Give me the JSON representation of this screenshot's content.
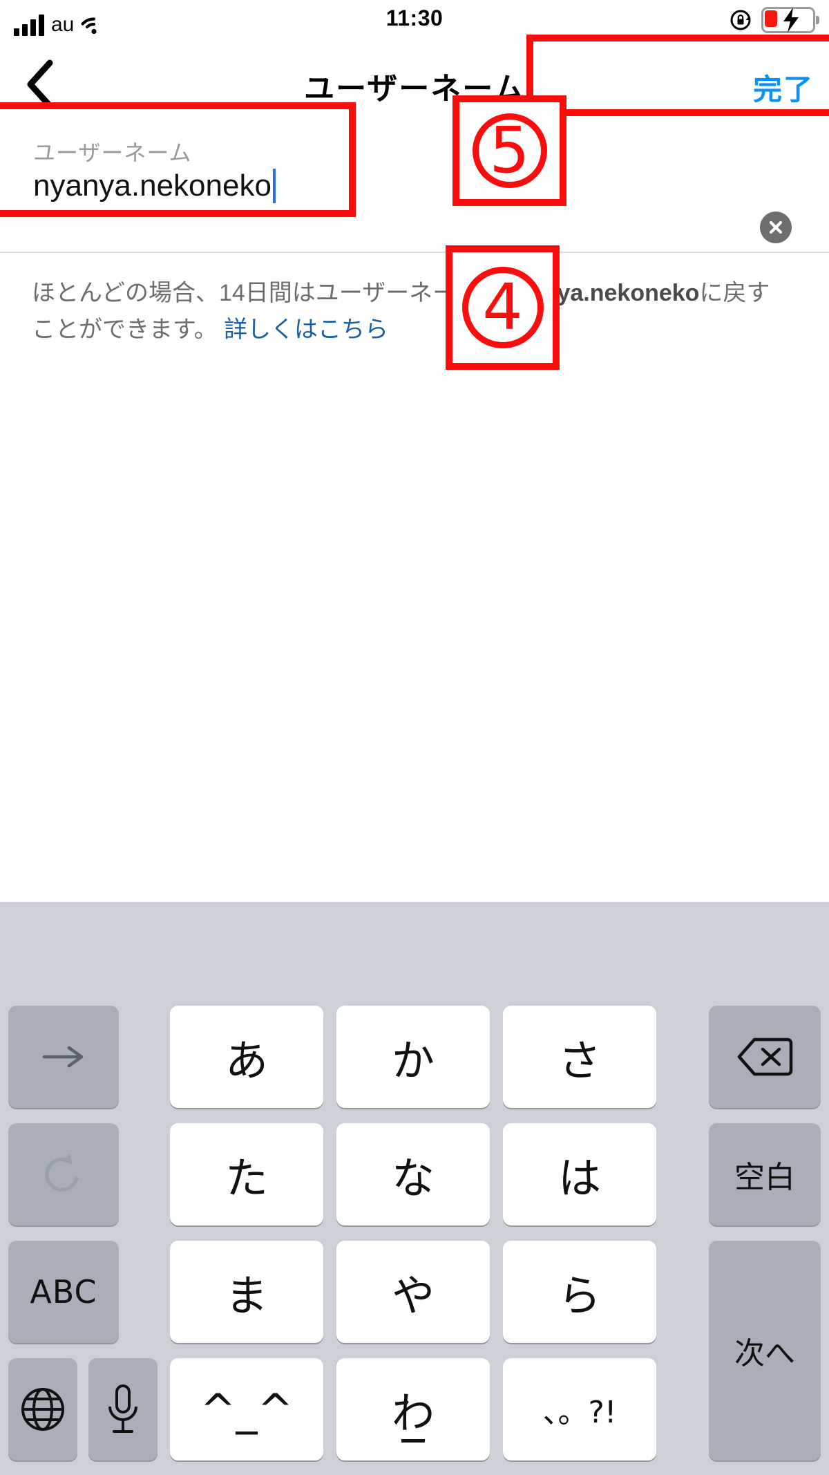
{
  "status_bar": {
    "carrier": "au",
    "time": "11:30",
    "signal_icon": "cellular-bars-icon",
    "wifi_icon": "wifi-icon",
    "rotation_lock_icon": "rotation-lock-icon",
    "battery_icon": "battery-charging-icon",
    "battery_level_color": "#f41b0e"
  },
  "nav_bar": {
    "back_icon": "chevron-left-icon",
    "title": "ユーザーネーム",
    "done_label": "完了",
    "done_color": "#0a93f5"
  },
  "field": {
    "label": "ユーザーネーム",
    "value": "nyanya.nekoneko",
    "caret_color": "#2b6fe8",
    "clear_icon": "clear-circle-x-icon"
  },
  "helper": {
    "part1": "ほとんどの場合、14日間はユーザーネームを",
    "username": "nyanya.nekoneko",
    "part2": "に戻すことができます。",
    "link": "詳しくはこちら",
    "link_color": "#1b5fa8"
  },
  "annotations": [
    {
      "id": "anno-field-box",
      "label": ""
    },
    {
      "id": "anno-done-box",
      "label": ""
    },
    {
      "badge": "④"
    },
    {
      "badge": "⑤"
    }
  ],
  "annotation_badges": {
    "four": "4",
    "five": "5"
  },
  "keyboard": {
    "background_color": "#cdd0d7",
    "rows": [
      [
        {
          "name": "key-move-cursor-right",
          "label": "→",
          "type": "grey",
          "icon": "arrow-right-icon"
        },
        {
          "name": "key-a",
          "label": "あ",
          "type": "white"
        },
        {
          "name": "key-ka",
          "label": "か",
          "type": "white"
        },
        {
          "name": "key-sa",
          "label": "さ",
          "type": "white"
        },
        {
          "name": "key-backspace",
          "label": "⌫",
          "type": "grey",
          "icon": "backspace-icon"
        }
      ],
      [
        {
          "name": "key-undo",
          "label": "↺",
          "type": "grey",
          "icon": "undo-icon",
          "dim": true
        },
        {
          "name": "key-ta",
          "label": "た",
          "type": "white"
        },
        {
          "name": "key-na",
          "label": "な",
          "type": "white"
        },
        {
          "name": "key-ha",
          "label": "は",
          "type": "white"
        },
        {
          "name": "key-space",
          "label": "空白",
          "type": "grey"
        }
      ],
      [
        {
          "name": "key-abc",
          "label": "ABC",
          "type": "grey"
        },
        {
          "name": "key-ma",
          "label": "ま",
          "type": "white"
        },
        {
          "name": "key-ya",
          "label": "や",
          "type": "white"
        },
        {
          "name": "key-ra",
          "label": "ら",
          "type": "white"
        },
        {
          "name": "key-next",
          "label": "次へ",
          "type": "grey"
        }
      ],
      [
        {
          "name": "key-globe",
          "label": "",
          "type": "grey",
          "icon": "globe-icon"
        },
        {
          "name": "key-microphone",
          "label": "",
          "type": "grey",
          "icon": "microphone-icon"
        },
        {
          "name": "key-emoticon",
          "label": "^_^",
          "type": "white"
        },
        {
          "name": "key-wa",
          "label": "わ",
          "type": "white"
        },
        {
          "name": "key-punctuation",
          "label": "、。?!",
          "type": "white"
        }
      ]
    ]
  }
}
